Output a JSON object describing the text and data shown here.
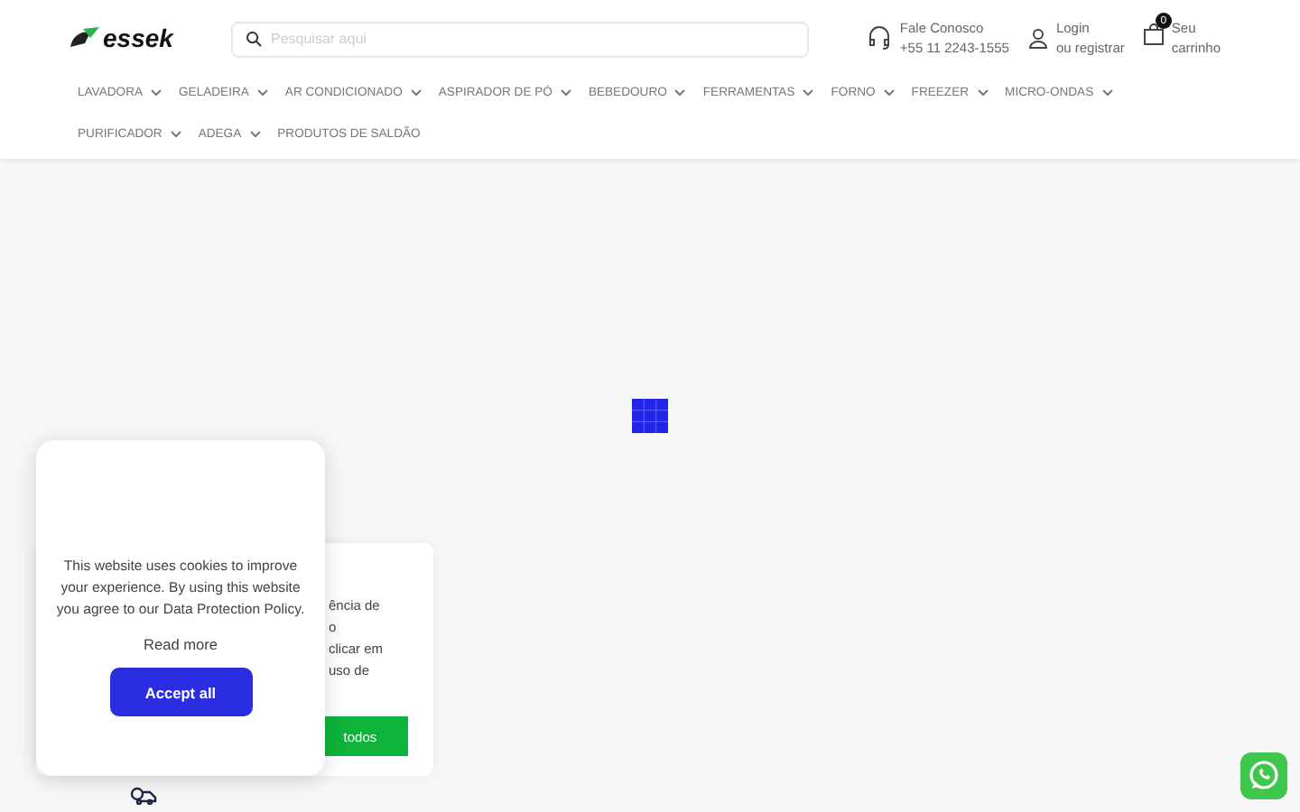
{
  "header": {
    "logo": "essek",
    "search": {
      "placeholder": "Pesquisar aqui"
    },
    "contact": {
      "title": "Fale Conosco",
      "phone": "+55 11 2243-1555"
    },
    "account": {
      "title": "Login",
      "subtitle": "ou registrar"
    },
    "cart": {
      "count": "0",
      "title": "Seu",
      "subtitle": "carrinho"
    }
  },
  "nav": [
    {
      "label": "LAVADORA",
      "dropdown": true
    },
    {
      "label": "GELADEIRA",
      "dropdown": true
    },
    {
      "label": "AR CONDICIONADO",
      "dropdown": true
    },
    {
      "label": "ASPIRADOR DE PÓ",
      "dropdown": true
    },
    {
      "label": "BEBEDOURO",
      "dropdown": true
    },
    {
      "label": "FERRAMENTAS",
      "dropdown": true
    },
    {
      "label": "FORNO",
      "dropdown": true
    },
    {
      "label": "FREEZER",
      "dropdown": true
    },
    {
      "label": "MICRO-ONDAS",
      "dropdown": true
    },
    {
      "label": "PURIFICADOR",
      "dropdown": true
    },
    {
      "label": "ADEGA",
      "dropdown": true
    },
    {
      "label": "PRODUTOS DE SALDÃO",
      "dropdown": false
    }
  ],
  "back_notice": {
    "lines": [
      "ência de",
      "o",
      "clicar em",
      "uso de"
    ],
    "button": "todos"
  },
  "cookie_notice": {
    "text": "This website uses cookies to improve your experience. By using this website you agree to our Data Protection Policy.",
    "read_more": "Read more",
    "button": "Accept all"
  }
}
